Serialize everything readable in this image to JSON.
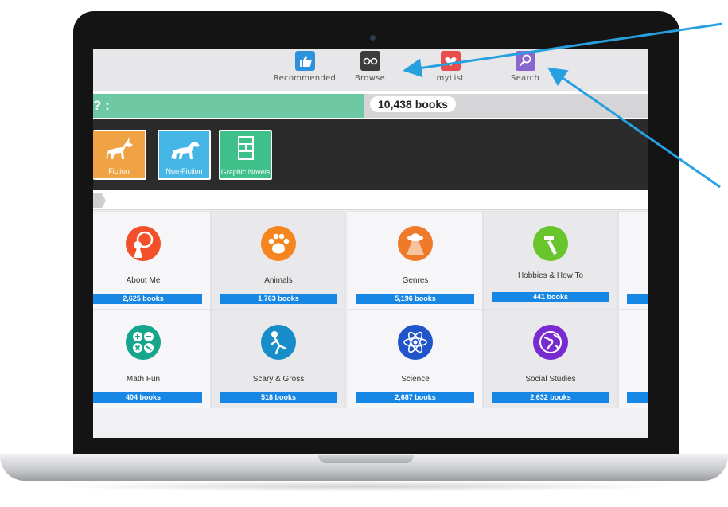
{
  "nav": {
    "recommended": "Recommended",
    "browse": "Browse",
    "mylist": "myList",
    "search": "Search"
  },
  "breadcrumb": "? :",
  "total_books": "10,438 books",
  "categories": [
    {
      "label": "Fiction",
      "color": "#f0a344"
    },
    {
      "label": "Non-Fiction",
      "color": "#45b6e6"
    },
    {
      "label": "Graphic Novels",
      "color": "#3fbf8a"
    }
  ],
  "topics": [
    {
      "name": "About Me",
      "count": "2,625 books",
      "color": "#f2502a",
      "icon": "girl-mirror-icon"
    },
    {
      "name": "Animals",
      "count": "1,763 books",
      "color": "#f5861f",
      "icon": "paw-icon"
    },
    {
      "name": "Genres",
      "count": "5,196 books",
      "color": "#ee7a2a",
      "icon": "ufo-icon"
    },
    {
      "name": "Hobbies & How To",
      "count": "441 books",
      "color": "#69c52c",
      "icon": "hammer-icon"
    },
    {
      "name": "Math Fun",
      "count": "404 books",
      "color": "#14a58c",
      "icon": "math-ops-icon"
    },
    {
      "name": "Scary & Gross",
      "count": "518 books",
      "color": "#178ec9",
      "icon": "skeleton-icon"
    },
    {
      "name": "Science",
      "count": "2,687 books",
      "color": "#2055c9",
      "icon": "atom-icon"
    },
    {
      "name": "Social Studies",
      "count": "2,632 books",
      "color": "#7a2ad1",
      "icon": "globe-icon"
    }
  ],
  "colors": {
    "accent_blue": "#1687e5",
    "green_bar": "#6fc8a4",
    "recommended": "#2d92de",
    "browse": "#3c3c3c",
    "mylist": "#e94c4c",
    "search": "#8a66cf",
    "callout": "#27a0e0"
  }
}
